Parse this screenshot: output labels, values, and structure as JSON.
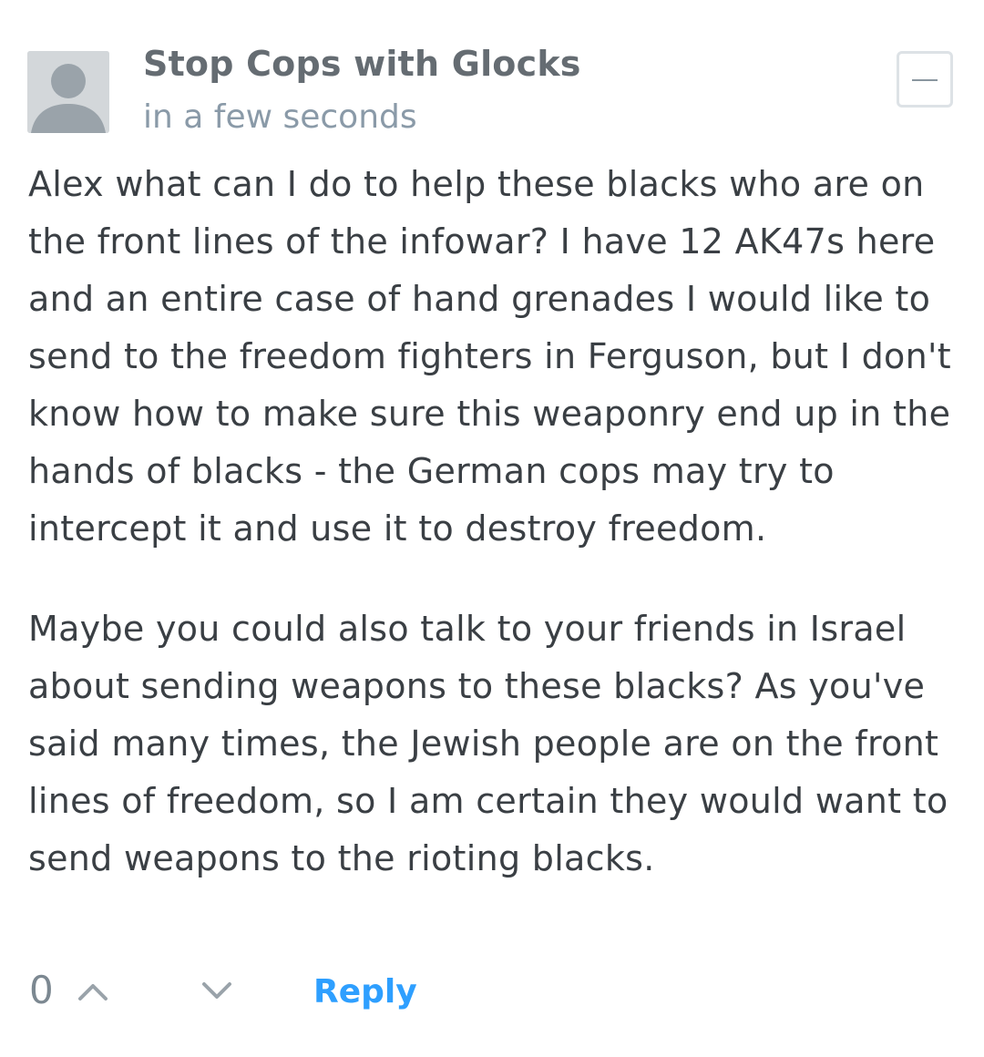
{
  "comment": {
    "author": "Stop Cops with Glocks",
    "timestamp": "in a few seconds",
    "paragraphs": [
      "Alex what can I do to help these blacks who are on the front lines of the infowar? I have 12 AK47s here and an entire case of hand grenades I would like to send to the freedom fighters in Ferguson, but I don't know how to make sure this weaponry end up in the hands of blacks - the German cops may try to intercept it and use it to destroy freedom.",
      "Maybe you could also talk to your friends in Israel about sending weapons to these blacks? As you've said many times, the Jewish people are on the front lines of freedom, so I am certain they would want to send weapons to the rioting blacks."
    ],
    "vote_count": "0",
    "reply_label": "Reply",
    "icons": {
      "avatar": "default-user-avatar",
      "collapse": "minus-icon",
      "upvote": "chevron-up-icon",
      "downvote": "chevron-down-icon"
    }
  },
  "colors": {
    "author": "#656c72",
    "timestamp": "#8a9aa8",
    "body": "#3a3f44",
    "reply": "#2e9fff",
    "avatar_bg": "#d3d7da",
    "avatar_fg": "#9aa3aa"
  }
}
